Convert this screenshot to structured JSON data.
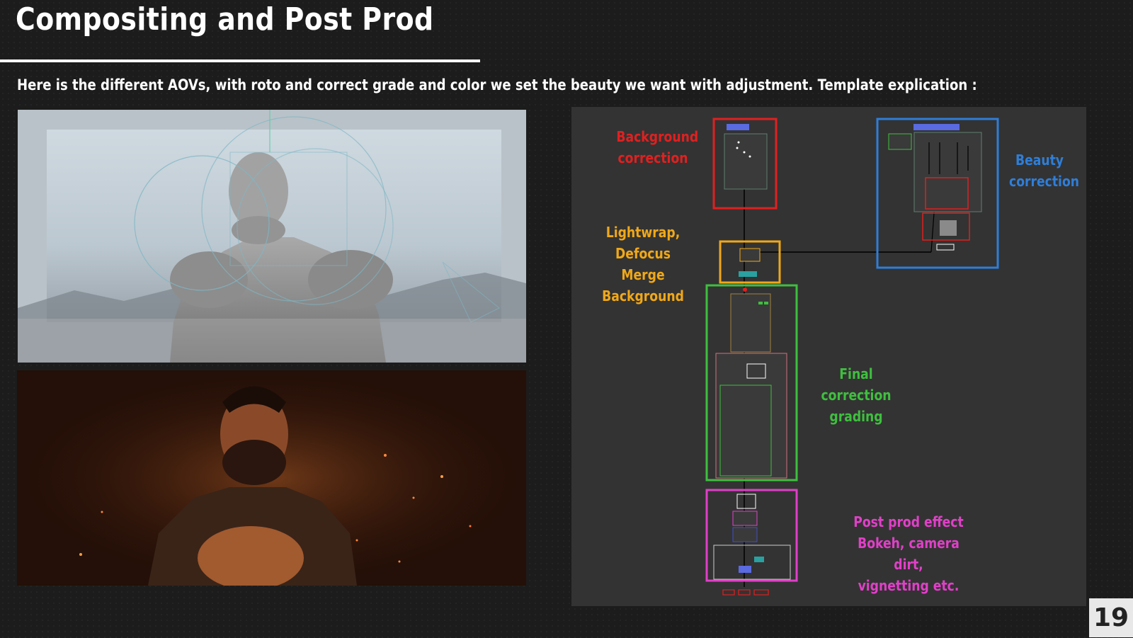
{
  "slide": {
    "title": "Compositing and Post Prod",
    "subtitle": "Here is the different AOVs, with roto and correct grade and color we set the beauty we want with adjustment. Template explication :",
    "page_number": "19"
  },
  "node_graph": {
    "sections": [
      {
        "label": "Background\ncorrection",
        "color": "#e02020"
      },
      {
        "label": "Beauty\ncorrection",
        "color": "#2f7ed8"
      },
      {
        "label": "Lightwrap,\nDefocus\nMerge Background",
        "color": "#f0a818"
      },
      {
        "label": "Final correction\ngrading",
        "color": "#3fbf3f"
      },
      {
        "label": "Post prod effect\nBokeh, camera dirt,\nvignetting etc.",
        "color": "#e040c8"
      }
    ]
  }
}
